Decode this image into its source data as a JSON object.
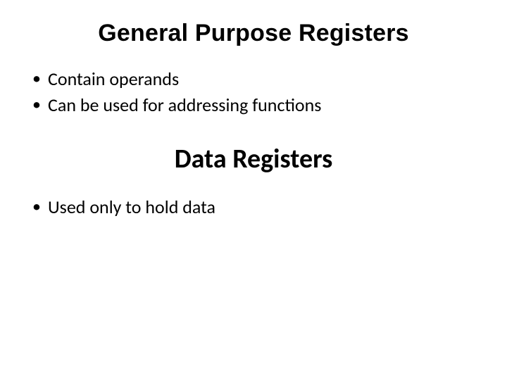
{
  "section1": {
    "title": "General Purpose Registers",
    "bullets": [
      "Contain operands",
      "Can be used for addressing functions"
    ]
  },
  "section2": {
    "title": "Data Registers",
    "bullets": [
      "Used only to hold data"
    ]
  }
}
